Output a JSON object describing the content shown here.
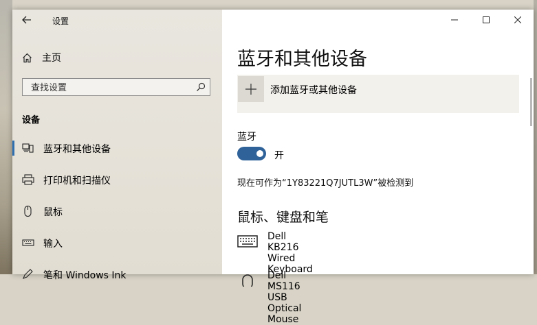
{
  "window": {
    "title": "设置"
  },
  "nav": {
    "home_label": "主页",
    "search_placeholder": "查找设置",
    "section_header": "设备",
    "items": [
      {
        "label": "蓝牙和其他设备",
        "icon": "bluetooth-devices-icon",
        "active": true
      },
      {
        "label": "打印机和扫描仪",
        "icon": "printer-icon",
        "active": false
      },
      {
        "label": "鼠标",
        "icon": "mouse-icon",
        "active": false
      },
      {
        "label": "输入",
        "icon": "keyboard-icon",
        "active": false
      },
      {
        "label": "笔和 Windows Ink",
        "icon": "pen-icon",
        "active": false
      }
    ]
  },
  "content": {
    "title": "蓝牙和其他设备",
    "add_device_label": "添加蓝牙或其他设备",
    "bluetooth_label": "蓝牙",
    "bluetooth_state": "开",
    "discoverable_text": "现在可作为“1Y83221Q7JUTL3W”被检测到",
    "section_mouse_keyboard": "鼠标、键盘和笔",
    "devices": [
      {
        "name": "Dell KB216 Wired Keyboard",
        "icon": "keyboard-icon"
      },
      {
        "name": "Dell MS116 USB Optical Mouse",
        "icon": "mouse-icon"
      }
    ]
  },
  "colors": {
    "accent": "#2f6299",
    "nav_bg": "#e6e2d9"
  }
}
